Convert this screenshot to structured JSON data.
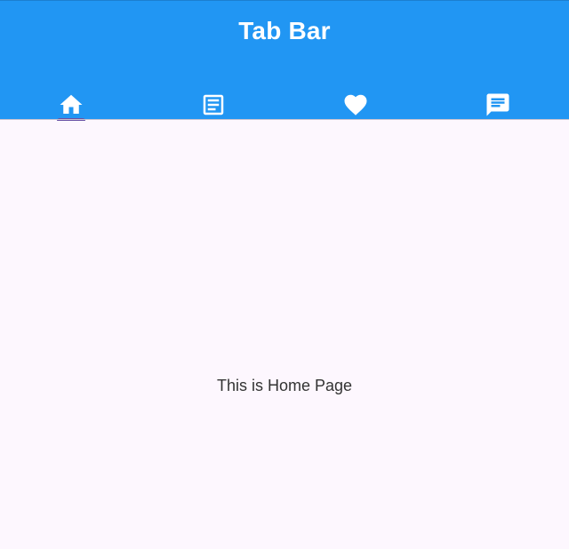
{
  "app": {
    "title": "Tab Bar",
    "colors": {
      "app_bar": "#2196f3",
      "background": "#fdf7fe",
      "indicator": "#6750a4",
      "icon": "#ffffff",
      "body_text": "#333333"
    }
  },
  "tabs": [
    {
      "icon": "home-icon",
      "selected": true
    },
    {
      "icon": "article-icon",
      "selected": false
    },
    {
      "icon": "heart-icon",
      "selected": false
    },
    {
      "icon": "chat-icon",
      "selected": false
    }
  ],
  "body": {
    "message": "This is Home Page"
  }
}
